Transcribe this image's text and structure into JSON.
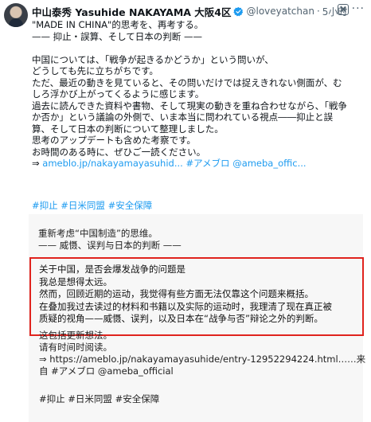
{
  "post": {
    "author_name": "中山泰秀 Yasuhide NAKAYAMA 大阪4区",
    "handle": "@loveyatchan",
    "dot": "·",
    "timestamp": "5小时",
    "more": "···",
    "body_lines": [
      "\"MADE IN CHINA\"的思考を、再考する。",
      "—— 抑止・誤算、そして日本の判断 ——",
      "",
      "中国については、「戦争が起きるかどうか」という問いが、",
      "どうしても先に立ちがちです。",
      "ただ、最近の動きを見ていると、その問いだけでは捉えきれない側面が、む",
      "しろ浮かび上がってくるように感じます。",
      "過去に読んできた資料や書物、そして現実の動きを重ね合わせながら、「戦争",
      "か否か」という議論の外側で、いま本当に問われている視点――抑止と誤",
      "算、そして日本の判断について整理しました。",
      "思考のアップデートも含めた考察です。",
      "お時間のある時に、ぜひご一読ください。"
    ],
    "link_line": {
      "arrow": "⇒",
      "url": "ameblo.jp/nakayamayasuhid...",
      "tag": "#アメブロ",
      "mention": "@ameba_offic..."
    },
    "hashtags": [
      "#抑止",
      "#日米同盟",
      "#安全保障"
    ]
  },
  "translation": {
    "top_lines": [
      "重新考虑“中国制造”的思维。",
      " —— 威慑、误判与日本的判断 ——"
    ],
    "highlighted_lines": [
      "关于中国，是否会爆发战争的问题是",
      "我总是想得太远。",
      "然而，回顾近期的运动，我觉得有些方面无法仅靠这个问题来概括。",
      "在叠加我过去读过的材料和书籍以及实际的运动时，我理清了现在真正被",
      "质疑的视角——威慑、误判，以及日本在“战争与否”辩论之外的判断。"
    ],
    "lower_lines": [
      "这包括更新想法。",
      "请有时间时阅读。",
      "⇒ https://ameblo.jp/nakayamayasuhide/entry-12952294224.html……来",
      "自 #アメブロ @ameba_official"
    ],
    "hashtags": "#抑止 #日米同盟 #安全保障"
  },
  "colors": {
    "link": "#1d9bf0",
    "highlight_border": "#e0231e",
    "panel_bg": "#f7f7f7"
  }
}
